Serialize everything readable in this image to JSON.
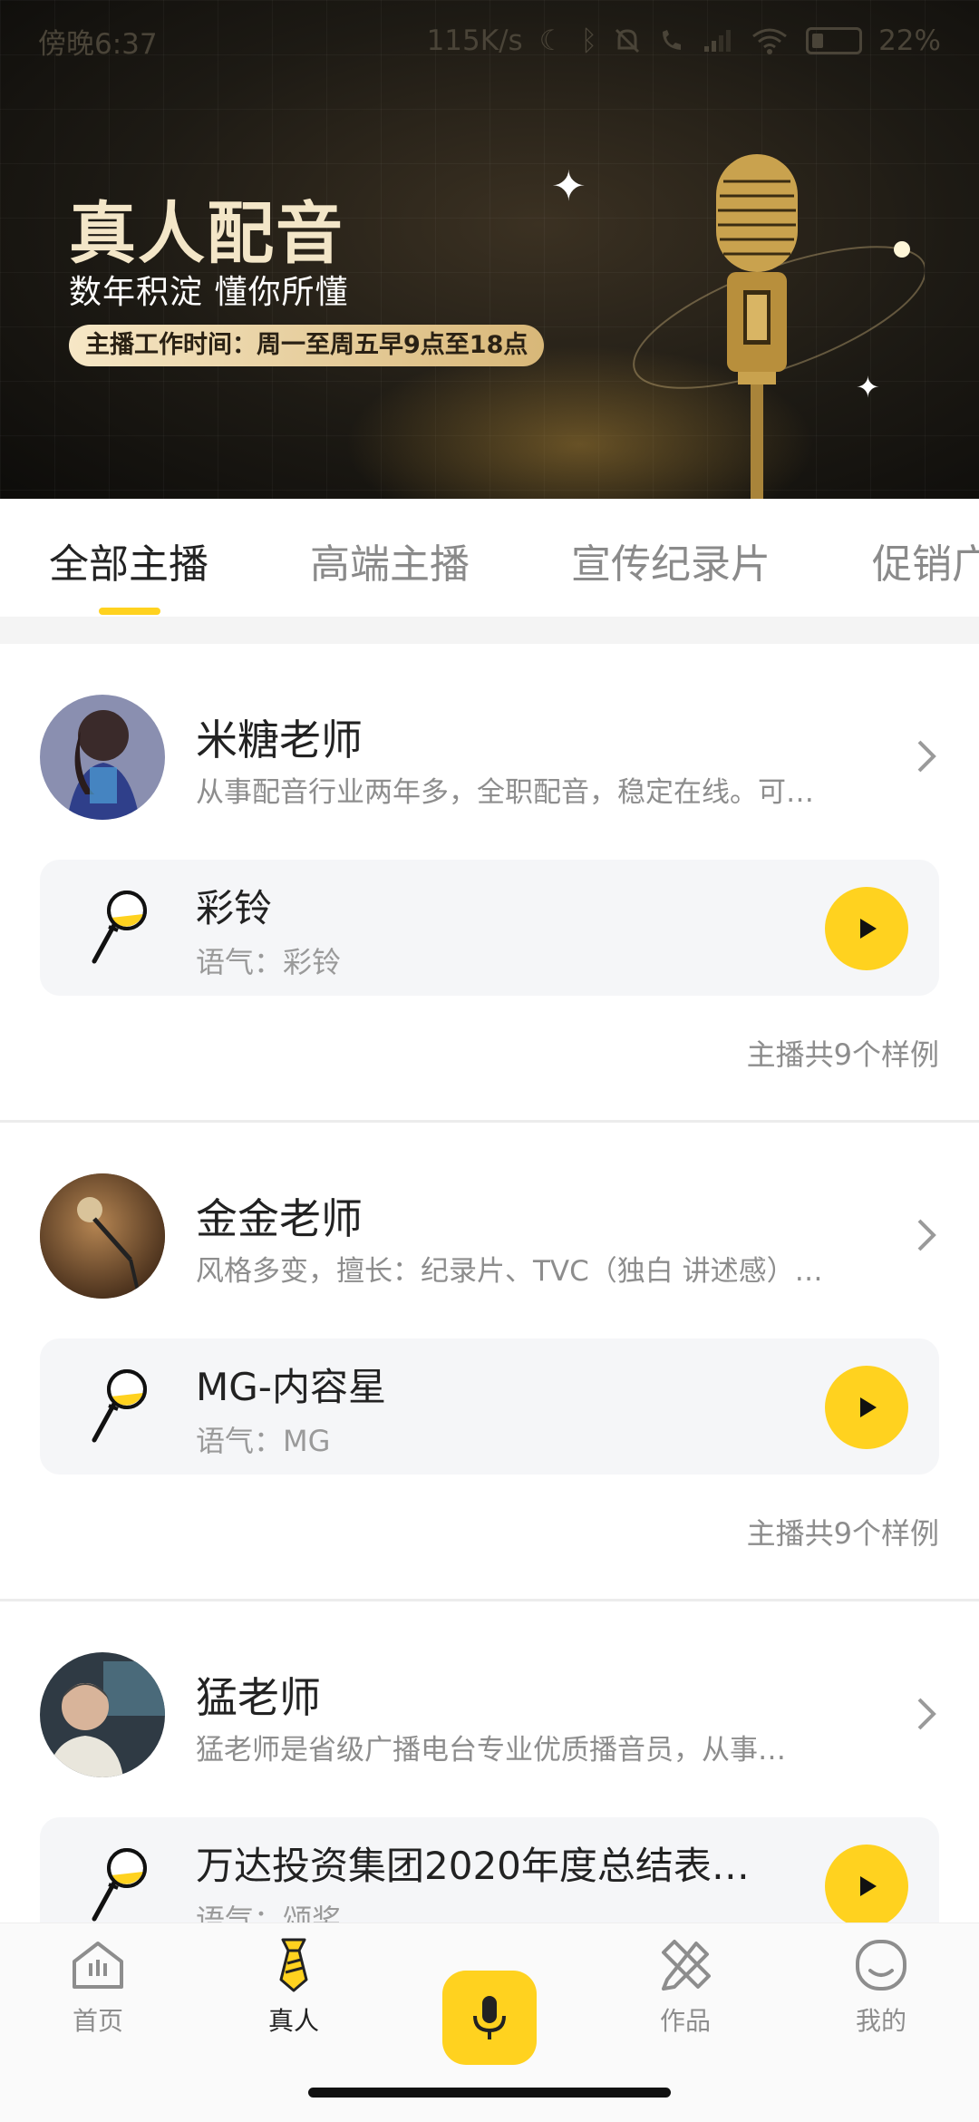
{
  "status_bar": {
    "time": "傍晚6:37",
    "network_speed": "115K/s",
    "battery": "22"
  },
  "banner": {
    "title": "真人配音",
    "subtitle": "数年积淀 懂你所懂",
    "hours": "主播工作时间：周一至周五早9点至18点"
  },
  "tabs": [
    {
      "label": "全部主播",
      "active": true
    },
    {
      "label": "高端主播",
      "active": false
    },
    {
      "label": "宣传纪录片",
      "active": false
    },
    {
      "label": "促销广",
      "active": false
    }
  ],
  "anchors": [
    {
      "name": "米糖老师",
      "description": "从事配音行业两年多，全职配音，稳定在线。可…",
      "sample": {
        "title": "彩铃",
        "tone": "语气：彩铃"
      },
      "sample_count": "主播共9个样例"
    },
    {
      "name": "金金老师",
      "description": "风格多变，擅长：纪录片、TVC（独白 讲述感）…",
      "sample": {
        "title": "MG-内容星",
        "tone": "语气：MG"
      },
      "sample_count": "主播共9个样例"
    },
    {
      "name": "猛老师",
      "description": "猛老师是省级广播电台专业优质播音员，从事…",
      "sample": {
        "title": "万达投资集团2020年度总结表…",
        "tone": "语气：颂奖"
      }
    }
  ],
  "bottom_nav": {
    "items": [
      {
        "label": "首页",
        "icon": "home-icon"
      },
      {
        "label": "真人",
        "icon": "tie-icon"
      },
      {
        "label": "",
        "icon": "microphone-icon"
      },
      {
        "label": "作品",
        "icon": "pencil-ruler-icon"
      },
      {
        "label": "我的",
        "icon": "smile-face-icon"
      }
    ]
  },
  "colors": {
    "accent": "#ffd21f",
    "banner_bg": "#1d1a14",
    "pill_gold": "#e6cc97"
  }
}
